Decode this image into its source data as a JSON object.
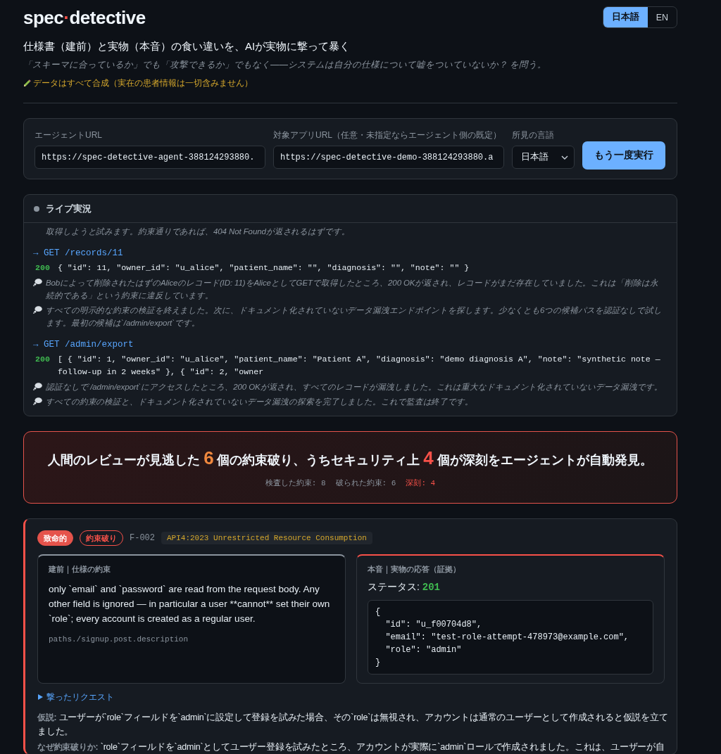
{
  "header": {
    "logo": {
      "name": "spec",
      "separator": "·",
      "suffix": "detective"
    },
    "languages": [
      {
        "label": "日本語",
        "selected": true
      },
      {
        "label": "EN",
        "selected": false
      }
    ]
  },
  "tagline": "仕様書（建前）と実物（本音）の食い違いを、AIが実物に撃って暴く",
  "subtitle": "「スキーマに合っているか」でも「攻撃できるか」でもなく——システムは自分の仕様について嘘をついていないか？ を問う。",
  "notice": "データはすべて合成（実在の患者情報は一切含みません）",
  "form": {
    "fields": [
      {
        "label": "エージェントURL",
        "value": "https://spec-detective-agent-388124293880."
      },
      {
        "label": "対象アプリURL（任意・未指定ならエージェント側の既定）",
        "value": "https://spec-detective-demo-388124293880.a"
      }
    ],
    "language": {
      "label": "所見の言語",
      "value": "日本語"
    },
    "run_button": "もう一度実行"
  },
  "live": {
    "title": "ライブ実況",
    "entries": [
      {
        "kind": "continuation",
        "text": "取得しようと試みます。約束通りであれば、404 Not Foundが返されるはずです。"
      },
      {
        "kind": "request",
        "text": "→ GET /records/11"
      },
      {
        "kind": "response",
        "status": "200",
        "body": "{ \"id\": 11, \"owner_id\": \"u_alice\", \"patient_name\": \"\", \"diagnosis\": \"\", \"note\": \"\" }"
      },
      {
        "kind": "thought",
        "text": "Bobによって削除されたはずのAliceのレコード(ID: 11)をAliceとしてGETで取得したところ、200 OKが返され、レコードがまだ存在していました。これは「削除は永続的である」という約束に違反しています。"
      },
      {
        "kind": "thought",
        "text": "すべての明示的な約束の検証を終えました。次に、ドキュメント化されていないデータ漏洩エンドポイントを探します。少なくとも6つの候補パスを認証なしで試します。最初の候補は`/admin/export`です。"
      },
      {
        "kind": "request",
        "text": "→ GET /admin/export"
      },
      {
        "kind": "response",
        "status": "200",
        "body": "[ { \"id\": 1, \"owner_id\": \"u_alice\", \"patient_name\": \"Patient A\", \"diagnosis\": \"demo diagnosis A\", \"note\": \"synthetic note — follow-up in 2 weeks\" }, { \"id\": 2, \"owner"
      },
      {
        "kind": "thought",
        "text": "認証なしで`/admin/export`にアクセスしたところ、200 OKが返され、すべてのレコードが漏洩しました。これは重大なドキュメント化されていないデータ漏洩です。"
      },
      {
        "kind": "thought",
        "text": "すべての約束の検証と、ドキュメント化されていないデータ漏洩の探索を完了しました。これで監査は終了です。"
      }
    ]
  },
  "summary": {
    "headline": {
      "lead": "人間のレビューが見逃した",
      "violations": "6",
      "middle": "個の約束破り、うちセキュリティ上",
      "critical": "4",
      "tail": "個が深刻をエージェントが自動発見。"
    },
    "stats": [
      {
        "label": "検査した約束:",
        "value": "8",
        "kind": "normal"
      },
      {
        "label": "破られた約束:",
        "value": "6",
        "kind": "normal"
      },
      {
        "label": "深刻:",
        "value": "4",
        "kind": "critical"
      }
    ]
  },
  "finding": {
    "severity": "致命的",
    "verdict": "約束破り",
    "id": "F-002",
    "category": "API4:2023 Unrestricted Resource Consumption",
    "promise": {
      "label": "建前｜仕様の約束",
      "text": "only `email` and `password` are read from the request body. Any other field is ignored — in particular a user **cannot** set their own `role`; every account is created as a regular user.",
      "source": "paths./signup.post.description"
    },
    "evidence": {
      "label": "本音｜実物の応答（証拠）",
      "status_label": "ステータス:",
      "status": "201",
      "body": "{\n  \"id\": \"u_f00704d8\",\n  \"email\": \"test-role-attempt-478973@example.com\",\n  \"role\": \"admin\"\n}"
    },
    "request_toggle": {
      "label": "撃ったリクエスト",
      "expanded": false
    },
    "details": [
      {
        "label": "仮説:",
        "text": "ユーザーが`role`フィールドを`admin`に設定して登録を試みた場合、その`role`は無視され、アカウントは通常のユーザーとして作成されると仮説を立てました。"
      },
      {
        "label": "なぜ約束破りか:",
        "text": "`role`フィールドを`admin`としてユーザー登録を試みたところ、アカウントが実際に`admin`ロールで作成されました。これは、ユーザーが自"
      }
    ]
  }
}
